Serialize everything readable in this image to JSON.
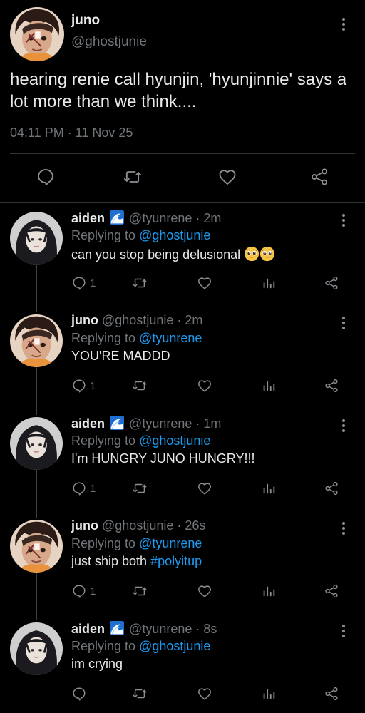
{
  "colors": {
    "background": "#000000",
    "text": "#e7e9ea",
    "muted": "#71767b",
    "link": "#1d9bf0",
    "divider": "#2f3336"
  },
  "main_tweet": {
    "author_name": "juno",
    "author_handle": "@ghostjunie",
    "text": "hearing renie call hyunjin, 'hyunjinnie' says a lot more than we think....",
    "timestamp": "04:11 PM · 11 Nov 25",
    "actions": [
      "reply-icon",
      "retweet-icon",
      "like-icon",
      "share-icon"
    ]
  },
  "replies": [
    {
      "author_name": "aiden",
      "emoji": "water-wave-emoji",
      "author_handle": "@tyunrene",
      "time": "· 2m",
      "replying_label": "Replying to",
      "replying_to": "@ghostjunie",
      "text": "can you stop being delusional",
      "trailing_emoji": [
        "pleading-face-emoji",
        "pleading-face-emoji"
      ],
      "reply_count": "1"
    },
    {
      "author_name": "juno",
      "author_handle": "@ghostjunie",
      "time": "· 2m",
      "replying_label": "Replying to",
      "replying_to": "@tyunrene",
      "text": "YOU'RE MADDD",
      "reply_count": "1"
    },
    {
      "author_name": "aiden",
      "emoji": "water-wave-emoji",
      "author_handle": "@tyunrene",
      "time": "· 1m",
      "replying_label": "Replying to",
      "replying_to": "@ghostjunie",
      "text": "I'm HUNGRY JUNO HUNGRY!!!",
      "reply_count": "1"
    },
    {
      "author_name": "juno",
      "author_handle": "@ghostjunie",
      "time": "· 26s",
      "replying_label": "Replying to",
      "replying_to": "@tyunrene",
      "text": "just ship both",
      "hashtag": "#polyitup",
      "reply_count": "1"
    },
    {
      "author_name": "aiden",
      "emoji": "water-wave-emoji",
      "author_handle": "@tyunrene",
      "time": "· 8s",
      "replying_label": "Replying to",
      "replying_to": "@ghostjunie",
      "text": "im crying",
      "reply_count": ""
    }
  ]
}
